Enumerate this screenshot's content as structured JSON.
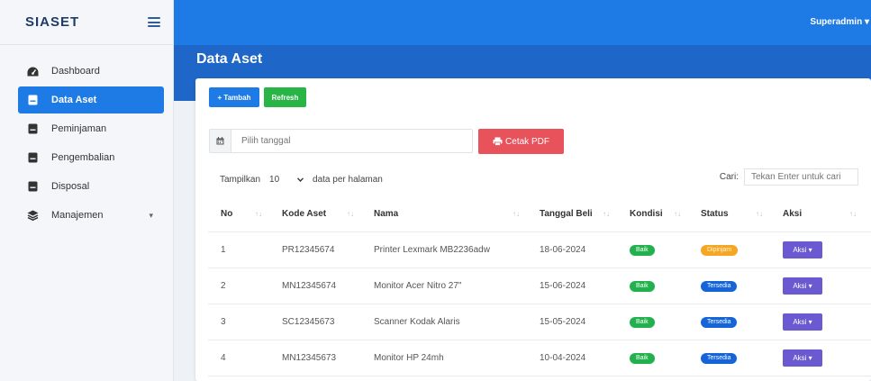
{
  "app": {
    "brand": "SIASET",
    "user": "Superadmin ▾"
  },
  "sidebar": {
    "items": [
      {
        "label": "Dashboard"
      },
      {
        "label": "Data Aset"
      },
      {
        "label": "Peminjaman"
      },
      {
        "label": "Pengembalian"
      },
      {
        "label": "Disposal"
      },
      {
        "label": "Manajemen",
        "caret": "▾"
      }
    ]
  },
  "page": {
    "title": "Data Aset"
  },
  "toolbar": {
    "tambah_label": "+ Tambah",
    "refresh_label": "Refresh"
  },
  "filter": {
    "date_placeholder": "Pilih tanggal",
    "pdf_label": "Cetak PDF"
  },
  "table_controls": {
    "show_label": "Tampilkan",
    "page_size": "10",
    "per_page_label": "data per halaman",
    "search_label": "Cari:",
    "search_placeholder": "Tekan Enter untuk cari"
  },
  "table": {
    "headers": [
      "No",
      "Kode Aset",
      "Nama",
      "Tanggal Beli",
      "Kondisi",
      "Status",
      "Aksi"
    ],
    "sort_glyph": "↑↓",
    "rows": [
      {
        "no": "1",
        "kode": "PR12345674",
        "nama": "Printer Lexmark MB2236adw",
        "tanggal": "18-06-2024",
        "kondisi": "Baik",
        "status": "Dipinjam",
        "aksi": "Aksi ▾"
      },
      {
        "no": "2",
        "kode": "MN12345674",
        "nama": "Monitor Acer Nitro 27\"",
        "tanggal": "15-06-2024",
        "kondisi": "Baik",
        "status": "Tersedia",
        "aksi": "Aksi ▾"
      },
      {
        "no": "3",
        "kode": "SC12345673",
        "nama": "Scanner Kodak Alaris",
        "tanggal": "15-05-2024",
        "kondisi": "Baik",
        "status": "Tersedia",
        "aksi": "Aksi ▾"
      },
      {
        "no": "4",
        "kode": "MN12345673",
        "nama": "Monitor HP 24mh",
        "tanggal": "10-04-2024",
        "kondisi": "Baik",
        "status": "Tersedia",
        "aksi": "Aksi ▾"
      }
    ]
  },
  "colors": {
    "primary": "#1e7be6",
    "band": "#1e66c8",
    "success": "#28b546",
    "danger": "#e8525b",
    "warning": "#f5a623",
    "aksi": "#6a59d1"
  },
  "icons": [
    "dashboard-icon",
    "document-icon",
    "book-icon",
    "layers-icon",
    "calendar-icon",
    "print-icon",
    "hamburger-icon"
  ]
}
